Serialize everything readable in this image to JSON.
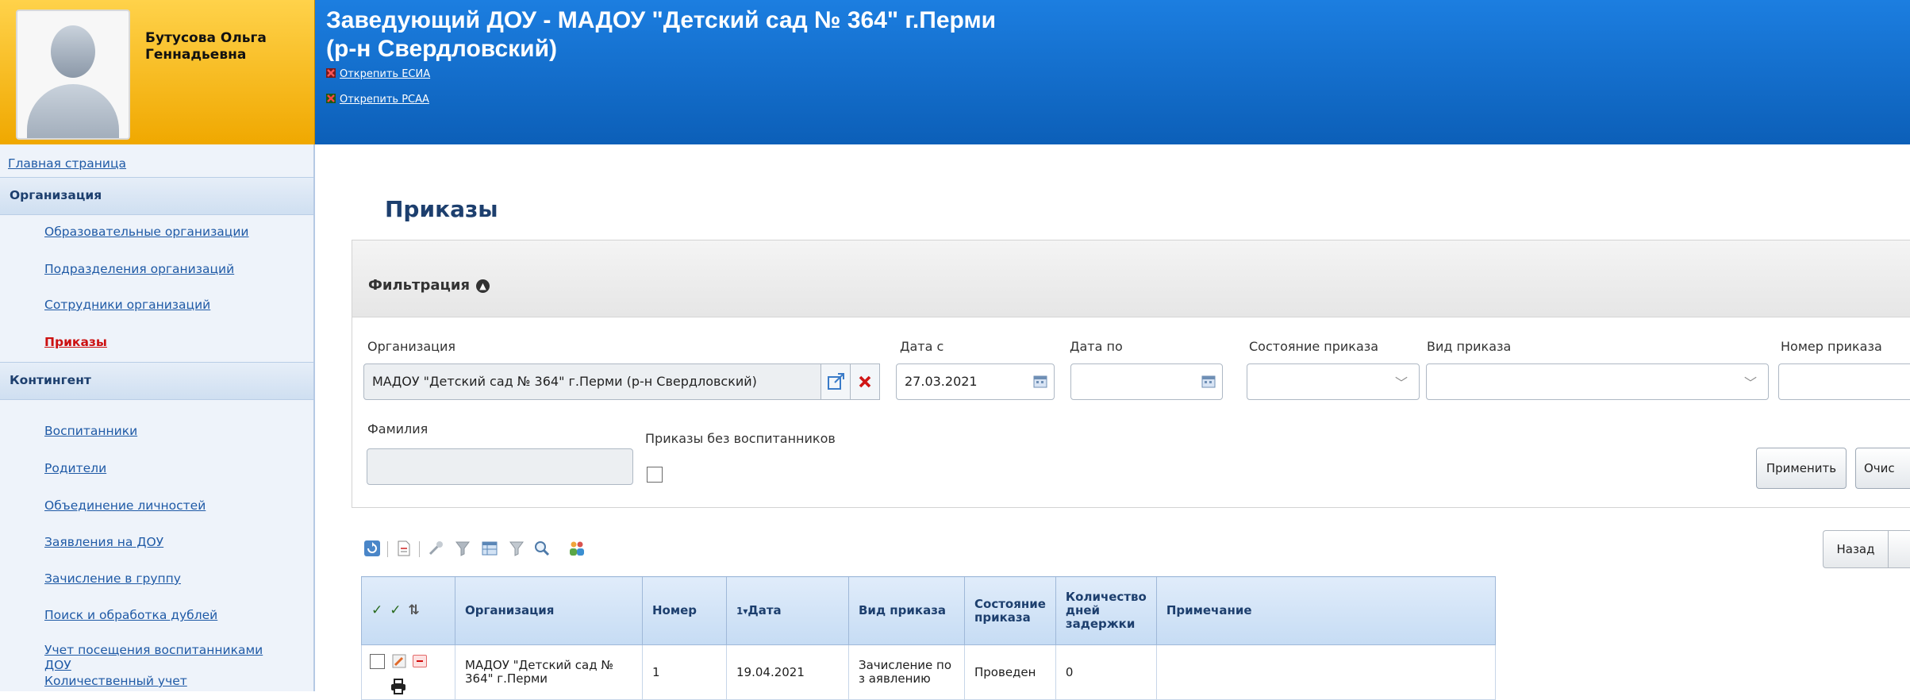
{
  "user": {
    "name_line1": "Бутусова Ольга",
    "name_line2": "Геннадьевна"
  },
  "header": {
    "title_line1": "Заведующий ДОУ - МАДОУ \"Детский сад № 364\" г.Перми",
    "title_line2": "(р-н Свердловский)",
    "unlink_esia": "Открепить ЕСИА",
    "unlink_rsaa": "Открепить РСАА"
  },
  "sidebar": {
    "home": "Главная страница",
    "sections": [
      {
        "title": "Организация",
        "items": [
          "Образовательные организации",
          "Подразделения организаций",
          "Сотрудники организаций",
          "Приказы"
        ]
      },
      {
        "title": "Контингент",
        "items": [
          "Воспитанники",
          "Родители",
          "Объединение личностей",
          "Заявления на ДОУ",
          "Зачисление в группу",
          "Поиск и обработка дублей",
          "Учет посещения воспитанниками ДОУ",
          "Количественный учет"
        ]
      }
    ]
  },
  "page": {
    "title": "Приказы"
  },
  "filter": {
    "title": "Фильтрация",
    "labels": {
      "organization": "Организация",
      "date_from": "Дата с",
      "date_to": "Дата по",
      "order_state": "Состояние приказа",
      "order_type": "Вид приказа",
      "order_number": "Номер приказа",
      "surname": "Фамилия",
      "no_pupils": "Приказы без воспитанников"
    },
    "values": {
      "organization": "МАДОУ \"Детский сад № 364\" г.Перми (р-н Свердловский)",
      "date_from": "27.03.2021",
      "date_to": "",
      "order_state": "",
      "order_type": "",
      "order_number": "",
      "surname": ""
    },
    "buttons": {
      "apply": "Применить",
      "clear": "Очис"
    }
  },
  "pagination": {
    "back": "Назад"
  },
  "table": {
    "columns": [
      "Организация",
      "Номер",
      "Дата",
      "Вид приказа",
      "Состояние приказа",
      "Количество дней задержки",
      "Примечание"
    ],
    "sort_indicator": "1▾",
    "rows": [
      {
        "organization": "МАДОУ \"Детский сад № 364\" г.Перми",
        "number": "1",
        "date": "19.04.2021",
        "type": "Зачисление по з аявлению",
        "state": "Проведен",
        "delay_days": "0",
        "note": ""
      }
    ]
  },
  "colors": {
    "header_blue": "#0c5fb8",
    "profile_yellow": "#f0a800",
    "active_link": "#cc1111",
    "link": "#1f5aa6"
  }
}
